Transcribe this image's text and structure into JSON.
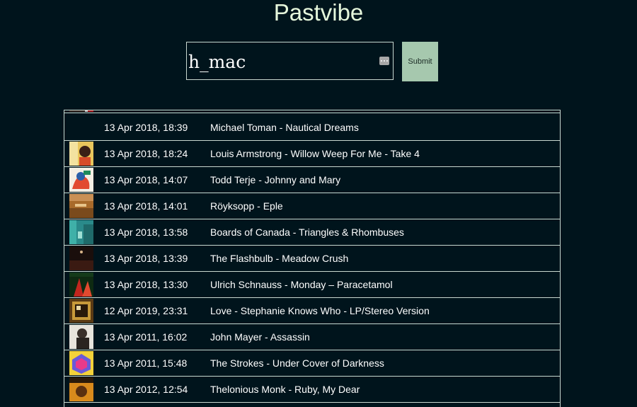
{
  "header": {
    "title": "Pastvibe"
  },
  "search": {
    "value": "h_mac",
    "icon": "dots-icon"
  },
  "submit_label": "Submit",
  "scrobbles": [
    {
      "timestamp": "",
      "track": "",
      "art": "art-partial"
    },
    {
      "timestamp": "13 Apr 2018, 18:39",
      "track": "Michael Toman - Nautical Dreams",
      "art": "none"
    },
    {
      "timestamp": "13 Apr 2018, 18:24",
      "track": "Louis Armstrong - Willow Weep For Me - Take 4",
      "art": "art-armstrong"
    },
    {
      "timestamp": "13 Apr 2018, 14:07",
      "track": "Todd Terje - Johnny and Mary",
      "art": "art-terje"
    },
    {
      "timestamp": "13 Apr 2018, 14:01",
      "track": "Röyksopp - Eple",
      "art": "art-royksopp"
    },
    {
      "timestamp": "13 Apr 2018, 13:58",
      "track": "Boards of Canada - Triangles & Rhombuses",
      "art": "art-boc"
    },
    {
      "timestamp": "13 Apr 2018, 13:39",
      "track": "The Flashbulb - Meadow Crush",
      "art": "art-flashbulb"
    },
    {
      "timestamp": "13 Apr 2018, 13:30",
      "track": "Ulrich Schnauss - Monday – Paracetamol",
      "art": "art-schnauss"
    },
    {
      "timestamp": "12 Apr 2019, 23:31",
      "track": "Love - Stephanie Knows Who - LP/Stereo Version",
      "art": "art-love"
    },
    {
      "timestamp": "13 Apr 2011, 16:02",
      "track": "John Mayer - Assassin",
      "art": "art-mayer"
    },
    {
      "timestamp": "13 Apr 2011, 15:48",
      "track": "The Strokes - Under Cover of Darkness",
      "art": "art-strokes"
    },
    {
      "timestamp": "13 Apr 2012, 12:54",
      "track": "Thelonious Monk - Ruby, My Dear",
      "art": "art-monk"
    }
  ]
}
